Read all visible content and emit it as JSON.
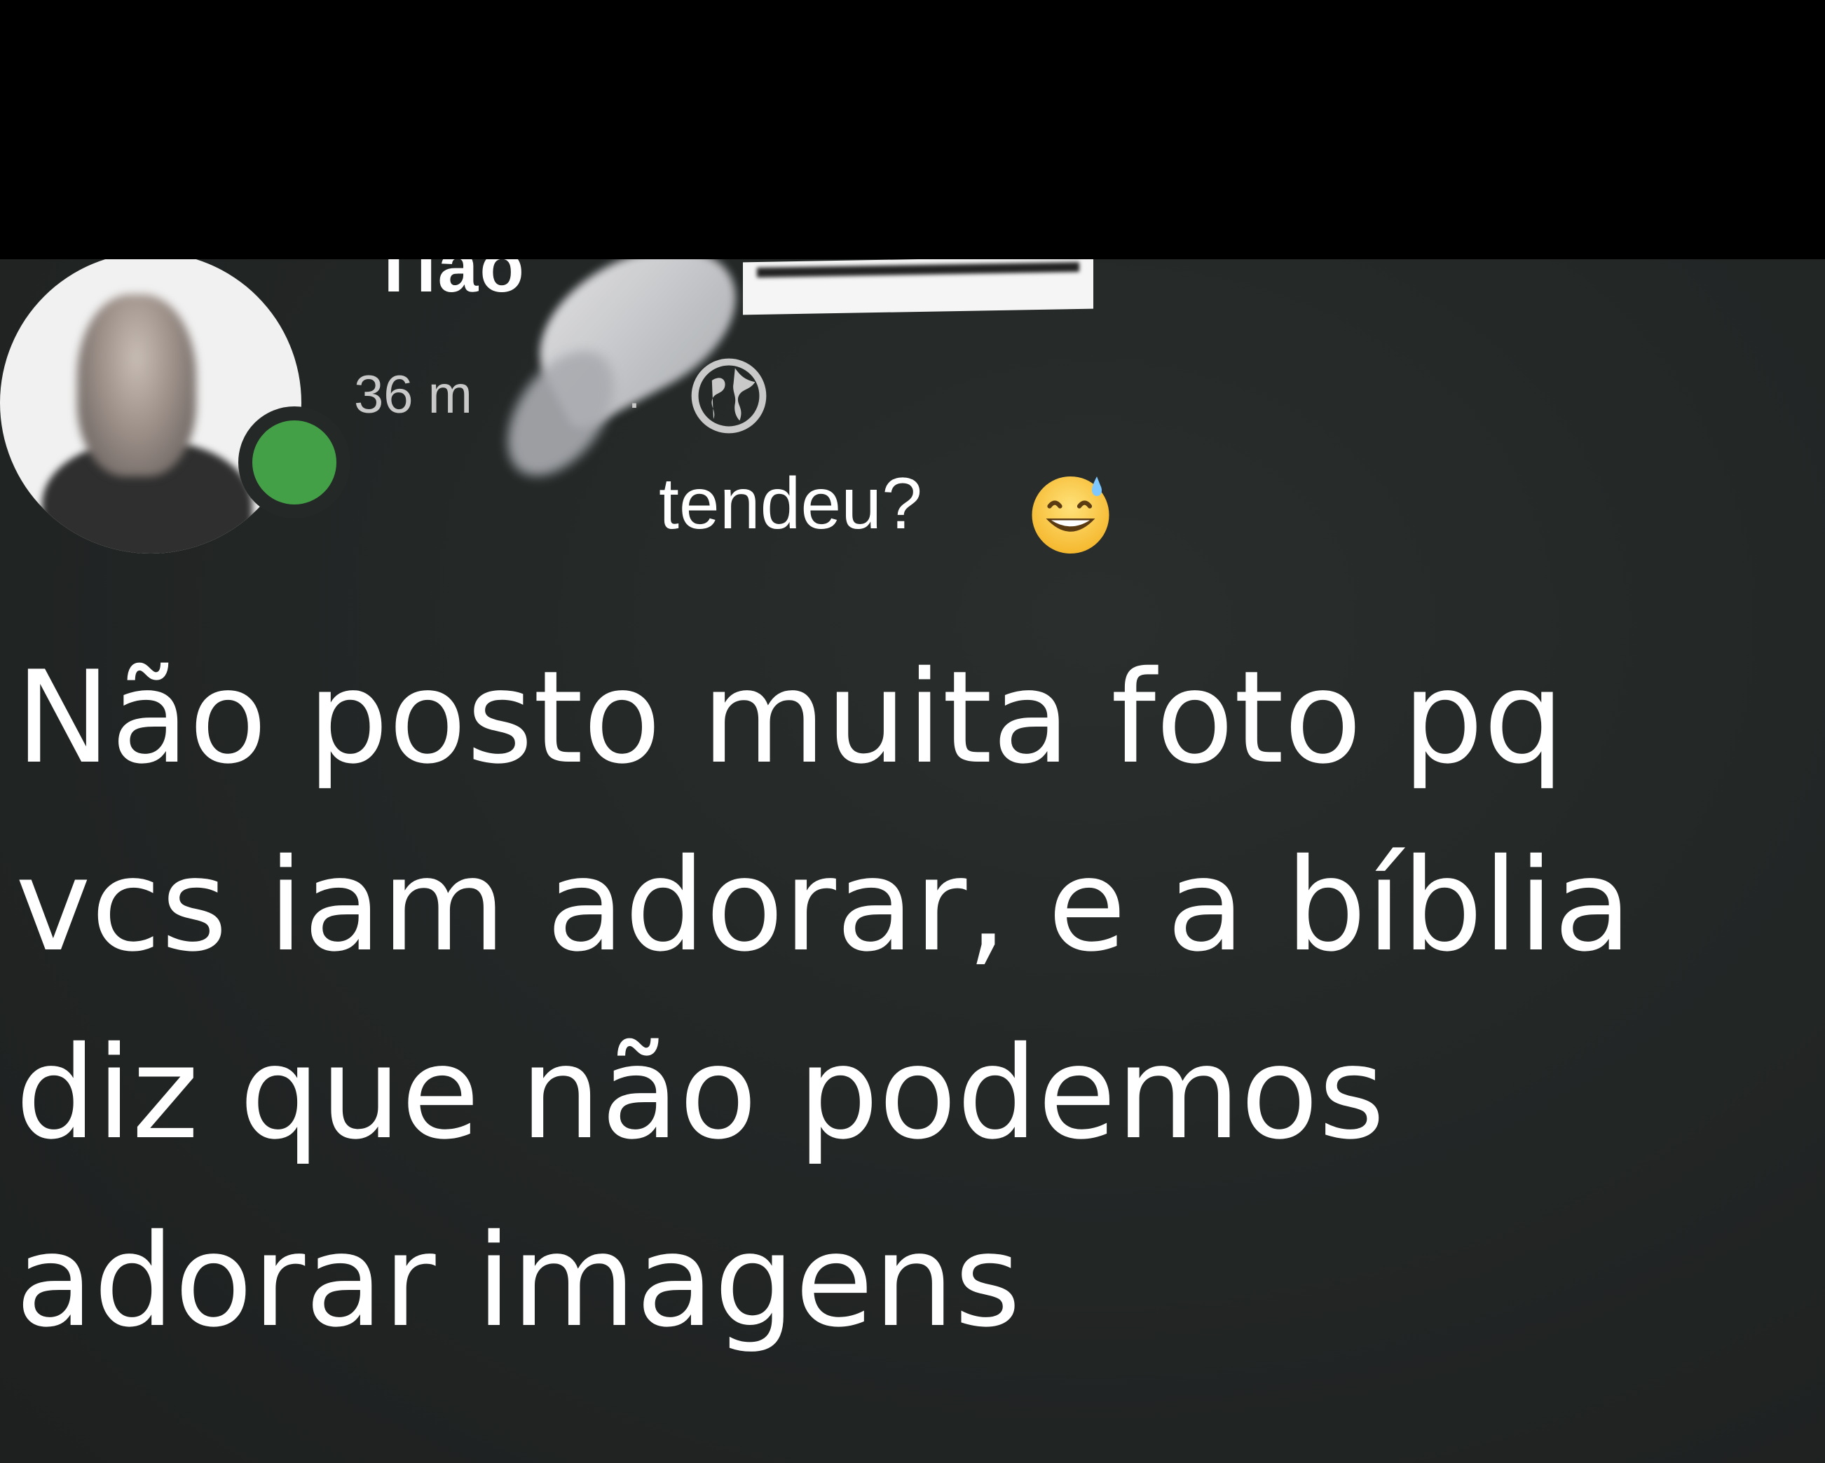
{
  "post": {
    "author_name": "Tiao",
    "timestamp": "36 m",
    "separator": "·",
    "caption": "tendeu?",
    "body_lines": [
      "Não posto muita foto pq",
      "vcs iam adorar, e a bíblia",
      "diz que não podemos",
      "adorar imagens"
    ]
  },
  "icons": {
    "audience": "globe-icon",
    "caption_emoji": "grinning-sweat-emoji-icon",
    "presence": "online-status-dot"
  },
  "colors": {
    "background": "#242827",
    "text": "#ffffff",
    "secondary_text": "#c9c9c9",
    "online": "#43a047"
  }
}
